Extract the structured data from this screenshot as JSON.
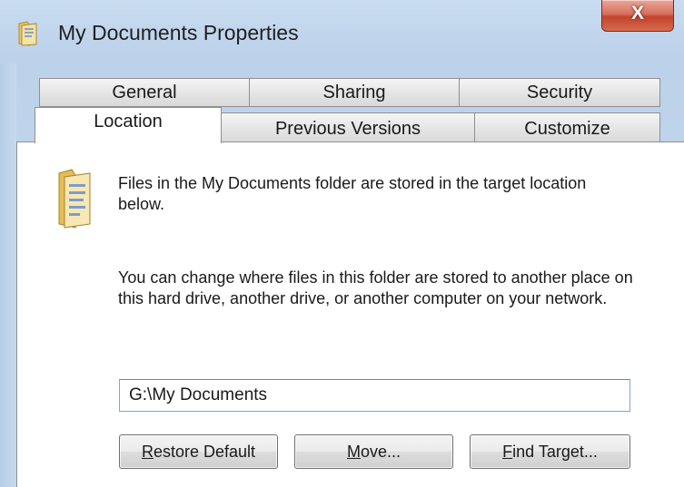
{
  "window": {
    "title": "My Documents Properties",
    "close_label": "X"
  },
  "tabs": {
    "row1": [
      {
        "label": "General"
      },
      {
        "label": "Sharing"
      },
      {
        "label": "Security"
      }
    ],
    "row2": [
      {
        "label": "Location",
        "active": true
      },
      {
        "label": "Previous Versions"
      },
      {
        "label": "Customize"
      }
    ]
  },
  "location": {
    "info_line1": "Files in the My Documents folder are stored in the target location below.",
    "info_line2": "You can change where files in this folder are stored to another place on this hard drive, another drive, or another computer on your network.",
    "path_value": "G:\\My Documents",
    "buttons": {
      "restore_default": {
        "mnemonic": "R",
        "rest": "estore Default"
      },
      "move": {
        "mnemonic": "M",
        "rest": "ove..."
      },
      "find_target": {
        "mnemonic": "F",
        "rest": "ind Target..."
      }
    }
  },
  "icons": {
    "title": "folder-documents-icon",
    "panel": "folder-documents-icon"
  }
}
